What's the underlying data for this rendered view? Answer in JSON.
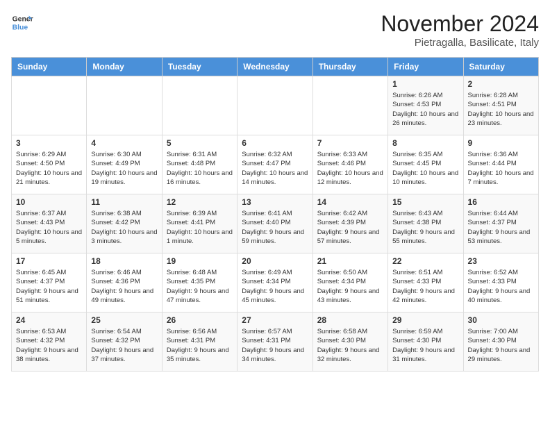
{
  "app": {
    "name1": "General",
    "name2": "Blue"
  },
  "header": {
    "month": "November 2024",
    "location": "Pietragalla, Basilicate, Italy"
  },
  "days_of_week": [
    "Sunday",
    "Monday",
    "Tuesday",
    "Wednesday",
    "Thursday",
    "Friday",
    "Saturday"
  ],
  "weeks": [
    [
      {
        "day": "",
        "info": ""
      },
      {
        "day": "",
        "info": ""
      },
      {
        "day": "",
        "info": ""
      },
      {
        "day": "",
        "info": ""
      },
      {
        "day": "",
        "info": ""
      },
      {
        "day": "1",
        "info": "Sunrise: 6:26 AM\nSunset: 4:53 PM\nDaylight: 10 hours and 26 minutes."
      },
      {
        "day": "2",
        "info": "Sunrise: 6:28 AM\nSunset: 4:51 PM\nDaylight: 10 hours and 23 minutes."
      }
    ],
    [
      {
        "day": "3",
        "info": "Sunrise: 6:29 AM\nSunset: 4:50 PM\nDaylight: 10 hours and 21 minutes."
      },
      {
        "day": "4",
        "info": "Sunrise: 6:30 AM\nSunset: 4:49 PM\nDaylight: 10 hours and 19 minutes."
      },
      {
        "day": "5",
        "info": "Sunrise: 6:31 AM\nSunset: 4:48 PM\nDaylight: 10 hours and 16 minutes."
      },
      {
        "day": "6",
        "info": "Sunrise: 6:32 AM\nSunset: 4:47 PM\nDaylight: 10 hours and 14 minutes."
      },
      {
        "day": "7",
        "info": "Sunrise: 6:33 AM\nSunset: 4:46 PM\nDaylight: 10 hours and 12 minutes."
      },
      {
        "day": "8",
        "info": "Sunrise: 6:35 AM\nSunset: 4:45 PM\nDaylight: 10 hours and 10 minutes."
      },
      {
        "day": "9",
        "info": "Sunrise: 6:36 AM\nSunset: 4:44 PM\nDaylight: 10 hours and 7 minutes."
      }
    ],
    [
      {
        "day": "10",
        "info": "Sunrise: 6:37 AM\nSunset: 4:43 PM\nDaylight: 10 hours and 5 minutes."
      },
      {
        "day": "11",
        "info": "Sunrise: 6:38 AM\nSunset: 4:42 PM\nDaylight: 10 hours and 3 minutes."
      },
      {
        "day": "12",
        "info": "Sunrise: 6:39 AM\nSunset: 4:41 PM\nDaylight: 10 hours and 1 minute."
      },
      {
        "day": "13",
        "info": "Sunrise: 6:41 AM\nSunset: 4:40 PM\nDaylight: 9 hours and 59 minutes."
      },
      {
        "day": "14",
        "info": "Sunrise: 6:42 AM\nSunset: 4:39 PM\nDaylight: 9 hours and 57 minutes."
      },
      {
        "day": "15",
        "info": "Sunrise: 6:43 AM\nSunset: 4:38 PM\nDaylight: 9 hours and 55 minutes."
      },
      {
        "day": "16",
        "info": "Sunrise: 6:44 AM\nSunset: 4:37 PM\nDaylight: 9 hours and 53 minutes."
      }
    ],
    [
      {
        "day": "17",
        "info": "Sunrise: 6:45 AM\nSunset: 4:37 PM\nDaylight: 9 hours and 51 minutes."
      },
      {
        "day": "18",
        "info": "Sunrise: 6:46 AM\nSunset: 4:36 PM\nDaylight: 9 hours and 49 minutes."
      },
      {
        "day": "19",
        "info": "Sunrise: 6:48 AM\nSunset: 4:35 PM\nDaylight: 9 hours and 47 minutes."
      },
      {
        "day": "20",
        "info": "Sunrise: 6:49 AM\nSunset: 4:34 PM\nDaylight: 9 hours and 45 minutes."
      },
      {
        "day": "21",
        "info": "Sunrise: 6:50 AM\nSunset: 4:34 PM\nDaylight: 9 hours and 43 minutes."
      },
      {
        "day": "22",
        "info": "Sunrise: 6:51 AM\nSunset: 4:33 PM\nDaylight: 9 hours and 42 minutes."
      },
      {
        "day": "23",
        "info": "Sunrise: 6:52 AM\nSunset: 4:33 PM\nDaylight: 9 hours and 40 minutes."
      }
    ],
    [
      {
        "day": "24",
        "info": "Sunrise: 6:53 AM\nSunset: 4:32 PM\nDaylight: 9 hours and 38 minutes."
      },
      {
        "day": "25",
        "info": "Sunrise: 6:54 AM\nSunset: 4:32 PM\nDaylight: 9 hours and 37 minutes."
      },
      {
        "day": "26",
        "info": "Sunrise: 6:56 AM\nSunset: 4:31 PM\nDaylight: 9 hours and 35 minutes."
      },
      {
        "day": "27",
        "info": "Sunrise: 6:57 AM\nSunset: 4:31 PM\nDaylight: 9 hours and 34 minutes."
      },
      {
        "day": "28",
        "info": "Sunrise: 6:58 AM\nSunset: 4:30 PM\nDaylight: 9 hours and 32 minutes."
      },
      {
        "day": "29",
        "info": "Sunrise: 6:59 AM\nSunset: 4:30 PM\nDaylight: 9 hours and 31 minutes."
      },
      {
        "day": "30",
        "info": "Sunrise: 7:00 AM\nSunset: 4:30 PM\nDaylight: 9 hours and 29 minutes."
      }
    ]
  ]
}
